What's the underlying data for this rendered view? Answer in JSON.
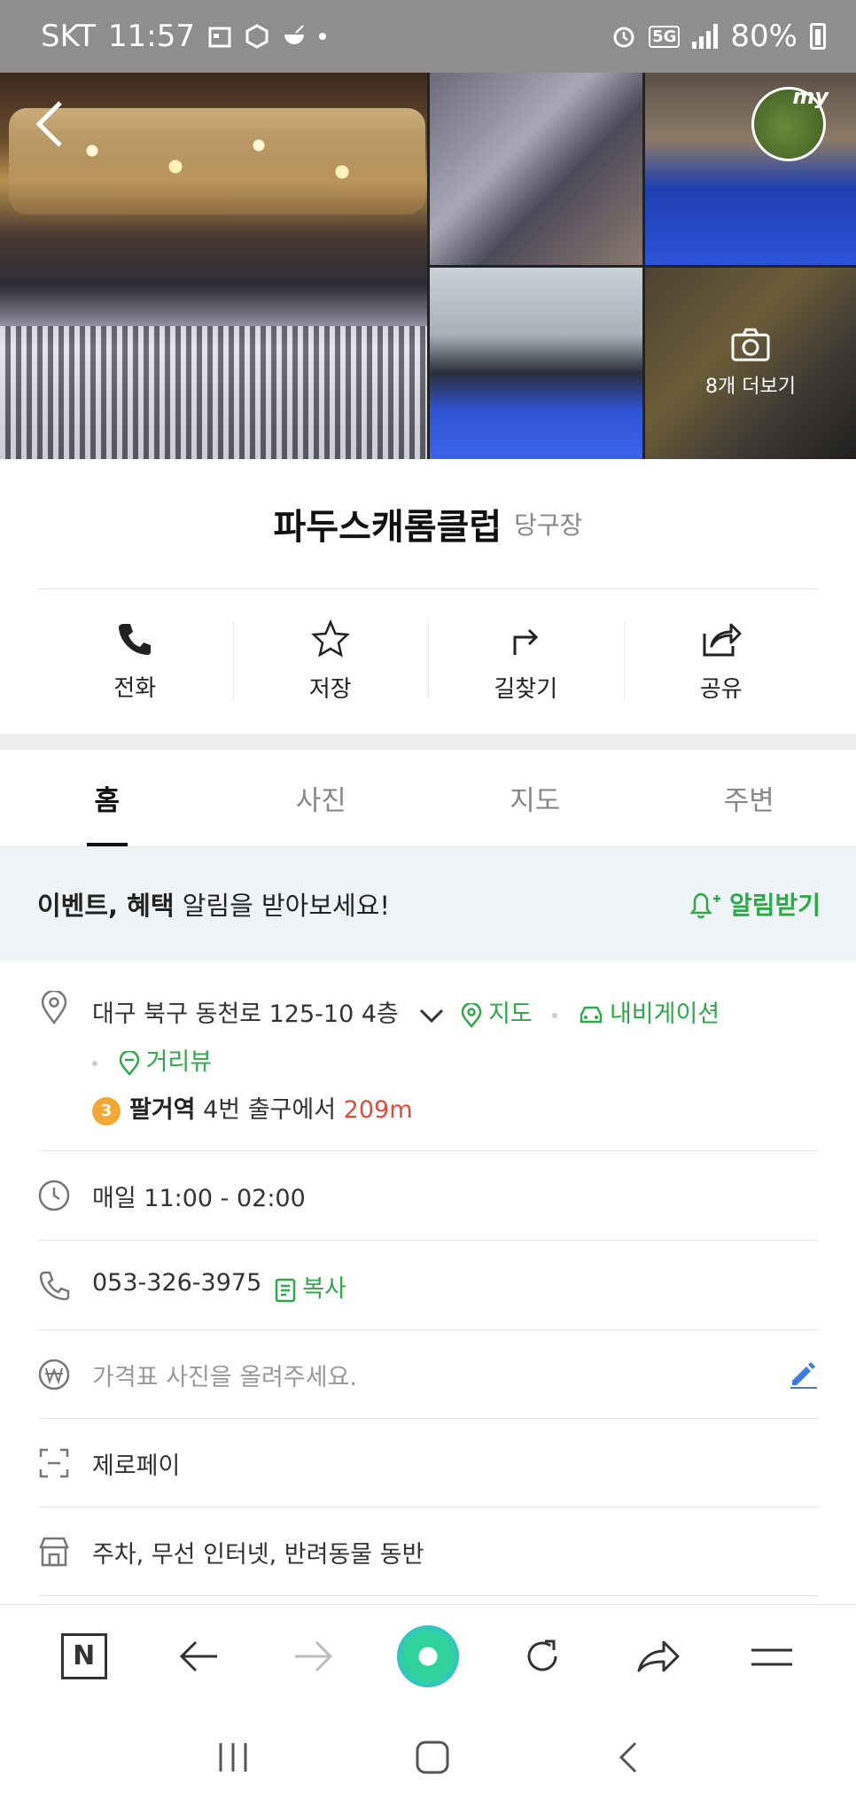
{
  "status_bar": {
    "carrier": "SKT",
    "time": "11:57",
    "network": "5G",
    "battery": "80%"
  },
  "photos": {
    "more_label": "8개 더보기",
    "my_badge": "my"
  },
  "place": {
    "name": "파두스캐롬클럽",
    "category": "당구장"
  },
  "actions": [
    {
      "label": "전화",
      "icon": "phone-icon"
    },
    {
      "label": "저장",
      "icon": "star-icon"
    },
    {
      "label": "길찾기",
      "icon": "directions-icon"
    },
    {
      "label": "공유",
      "icon": "share-icon"
    }
  ],
  "tabs": [
    {
      "label": "홈",
      "active": true
    },
    {
      "label": "사진",
      "active": false
    },
    {
      "label": "지도",
      "active": false
    },
    {
      "label": "주변",
      "active": false
    }
  ],
  "event_banner": {
    "bold": "이벤트, 혜택",
    "text": " 알림을 받아보세요!",
    "button": "알림받기"
  },
  "info": {
    "address": "대구 북구 동천로 125-10 4층",
    "map_link": "지도",
    "navigation_link": "내비게이션",
    "streetview_link": "거리뷰",
    "subway_line": "3",
    "subway_station": "팔거역",
    "subway_exit": " 4번 출구에서 ",
    "subway_distance": "209m",
    "hours": "매일 11:00 - 02:00",
    "phone": "053-326-3975",
    "copy_label": "복사",
    "price_placeholder": "가격표 사진을 올려주세요.",
    "payment": "제로페이",
    "amenities": "주차, 무선 인터넷, 반려동물 동반"
  },
  "colors": {
    "accent_green": "#2ea84b",
    "distance_red": "#e04b3a",
    "edit_blue": "#3b7be8",
    "subway_orange": "#f3a735"
  }
}
